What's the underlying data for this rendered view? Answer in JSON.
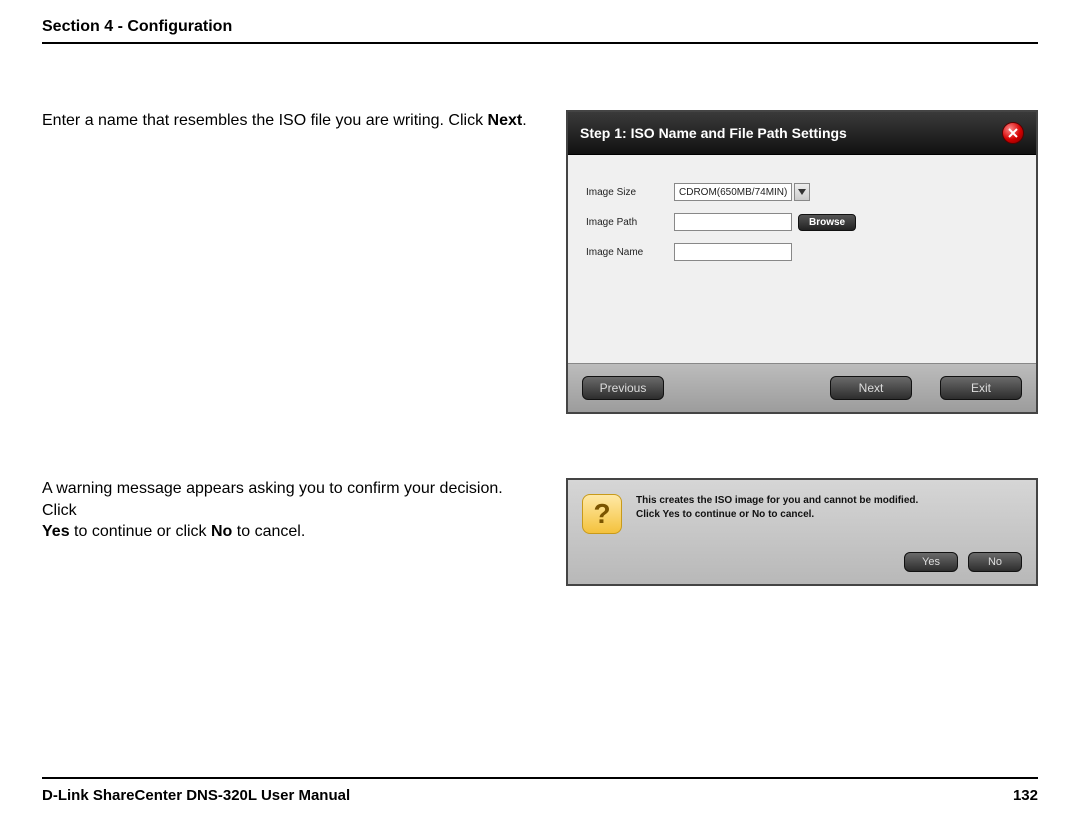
{
  "header": {
    "section": "Section 4 - Configuration"
  },
  "intro1": {
    "pre": "Enter a name that resembles the ISO file you are writing. Click ",
    "bold": "Next",
    "post": "."
  },
  "wizard": {
    "title": "Step 1: ISO Name and File Path Settings",
    "labels": {
      "image_size": "Image Size",
      "image_path": "Image Path",
      "image_name": "Image Name"
    },
    "image_size_value": "CDROM(650MB/74MIN)",
    "browse": "Browse",
    "previous": "Previous",
    "next": "Next",
    "exit": "Exit"
  },
  "intro2": {
    "line1_pre": "A warning message appears asking you to confirm your decision. Click ",
    "line2_bold1": "Yes",
    "line2_mid": " to continue or click ",
    "line2_bold2": "No",
    "line2_post": " to cancel."
  },
  "confirm": {
    "msg_line1": "This creates the ISO image for you and cannot be modified.",
    "msg_line2": "Click Yes to continue or No to cancel.",
    "yes": "Yes",
    "no": "No"
  },
  "footer": {
    "manual": "D-Link ShareCenter DNS-320L User Manual",
    "page": "132"
  }
}
